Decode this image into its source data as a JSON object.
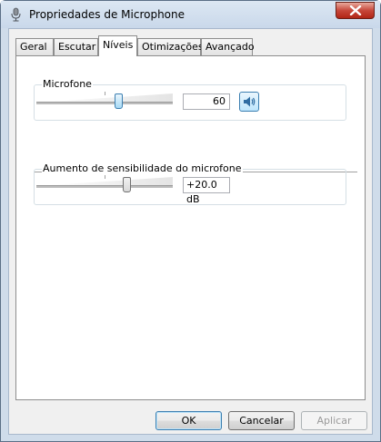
{
  "window": {
    "title": "Propriedades de Microphone",
    "icon": "microphone-icon",
    "close_icon": "close-icon"
  },
  "tabs": [
    {
      "label": "Geral"
    },
    {
      "label": "Escutar"
    },
    {
      "label": "Níveis",
      "active": true
    },
    {
      "label": "Otimizações"
    },
    {
      "label": "Avançado"
    }
  ],
  "levels": {
    "microphone": {
      "label": "Microfone",
      "value": "60",
      "level": 60,
      "speaker_icon": "speaker-icon"
    },
    "boost": {
      "label": "Aumento de sensibilidade do microfone",
      "value": "+20.0 dB",
      "level": 67
    }
  },
  "buttons": {
    "ok": "OK",
    "cancel": "Cancelar",
    "apply": "Aplicar"
  },
  "colors": {
    "accent": "#3c7fb1",
    "close_red": "#c7473a"
  }
}
